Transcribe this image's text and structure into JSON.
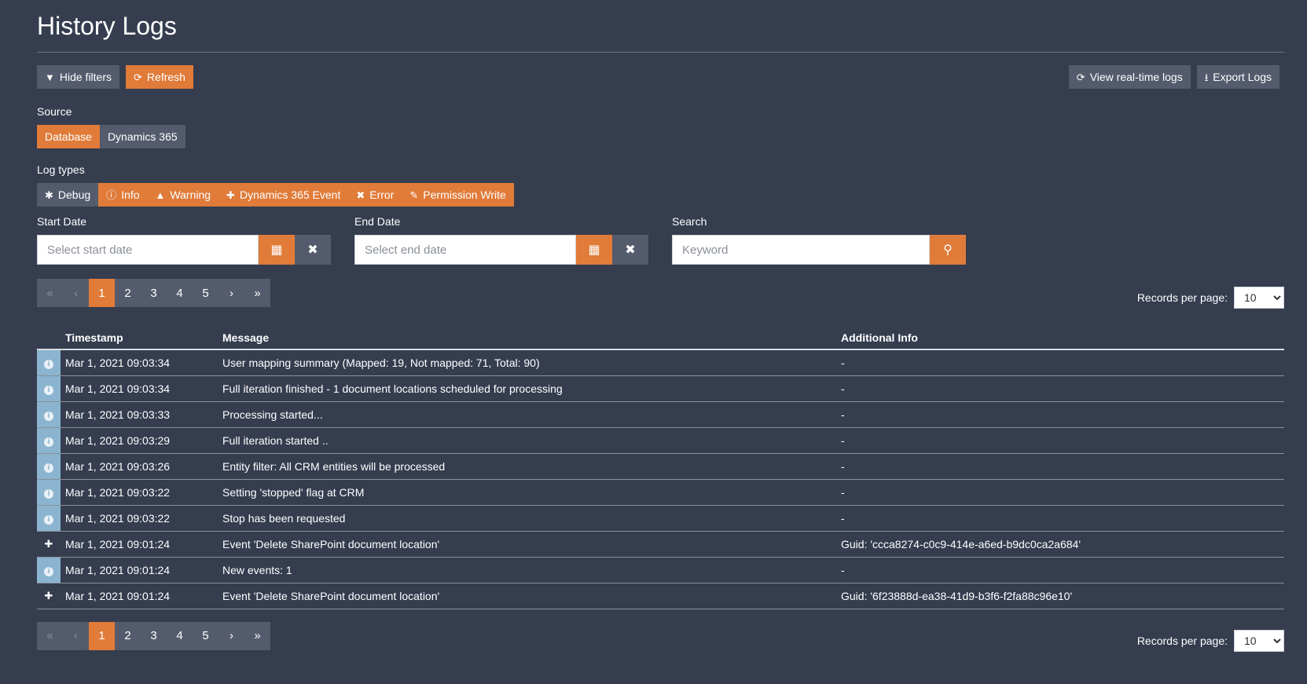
{
  "page_title": "History Logs",
  "toolbar": {
    "hide_filters": "Hide filters",
    "refresh": "Refresh",
    "view_realtime": "View real-time logs",
    "export": "Export Logs"
  },
  "source": {
    "label": "Source",
    "options": [
      "Database",
      "Dynamics 365"
    ]
  },
  "log_types": {
    "label": "Log types",
    "options": [
      "Debug",
      "Info",
      "Warning",
      "Dynamics 365 Event",
      "Error",
      "Permission Write"
    ]
  },
  "start_date": {
    "label": "Start Date",
    "placeholder": "Select start date"
  },
  "end_date": {
    "label": "End Date",
    "placeholder": "Select end date"
  },
  "search": {
    "label": "Search",
    "placeholder": "Keyword"
  },
  "pagination": {
    "first": "«",
    "prev": "‹",
    "next": "›",
    "last": "»",
    "pages": [
      "1",
      "2",
      "3",
      "4",
      "5"
    ],
    "current": "1"
  },
  "records_per_page": {
    "label": "Records per page:",
    "value": "10"
  },
  "table": {
    "headers": {
      "timestamp": "Timestamp",
      "message": "Message",
      "info": "Additional Info"
    },
    "rows": [
      {
        "type": "info",
        "timestamp": "Mar 1, 2021 09:03:34",
        "message": "User mapping summary (Mapped: 19, Not mapped: 71, Total: 90)",
        "info": "-"
      },
      {
        "type": "info",
        "timestamp": "Mar 1, 2021 09:03:34",
        "message": "Full iteration finished - 1 document locations scheduled for processing",
        "info": "-"
      },
      {
        "type": "info",
        "timestamp": "Mar 1, 2021 09:03:33",
        "message": "Processing started...",
        "info": "-"
      },
      {
        "type": "info",
        "timestamp": "Mar 1, 2021 09:03:29",
        "message": "Full iteration started ..",
        "info": "-"
      },
      {
        "type": "info",
        "timestamp": "Mar 1, 2021 09:03:26",
        "message": "Entity filter: All CRM entities will be processed",
        "info": "-"
      },
      {
        "type": "info",
        "timestamp": "Mar 1, 2021 09:03:22",
        "message": "Setting 'stopped' flag at CRM",
        "info": "-"
      },
      {
        "type": "info",
        "timestamp": "Mar 1, 2021 09:03:22",
        "message": "Stop has been requested",
        "info": "-"
      },
      {
        "type": "event",
        "timestamp": "Mar 1, 2021 09:01:24",
        "message": "Event 'Delete SharePoint document location'",
        "info": "Guid: 'ccca8274-c0c9-414e-a6ed-b9dc0ca2a684'"
      },
      {
        "type": "info",
        "timestamp": "Mar 1, 2021 09:01:24",
        "message": "New events: 1",
        "info": "-"
      },
      {
        "type": "event",
        "timestamp": "Mar 1, 2021 09:01:24",
        "message": "Event 'Delete SharePoint document location'",
        "info": "Guid: '6f23888d-ea38-41d9-b3f6-f2fa88c96e10'"
      }
    ]
  },
  "colors": {
    "background": "#353d4f",
    "accent": "#e07b39",
    "button": "#545b6c",
    "info_cell": "#8ab4cf"
  },
  "icons": {
    "hide_filters": "filter-icon",
    "refresh": "refresh-icon",
    "view_realtime": "refresh-icon",
    "export": "download-icon",
    "calendar": "calendar-icon",
    "clear": "close-icon",
    "search": "search-icon",
    "debug": "bug-icon",
    "info": "info-circle-icon",
    "warning": "warning-triangle-icon",
    "event": "plus-icon",
    "error": "error-circle-icon",
    "permission": "pencil-icon"
  }
}
